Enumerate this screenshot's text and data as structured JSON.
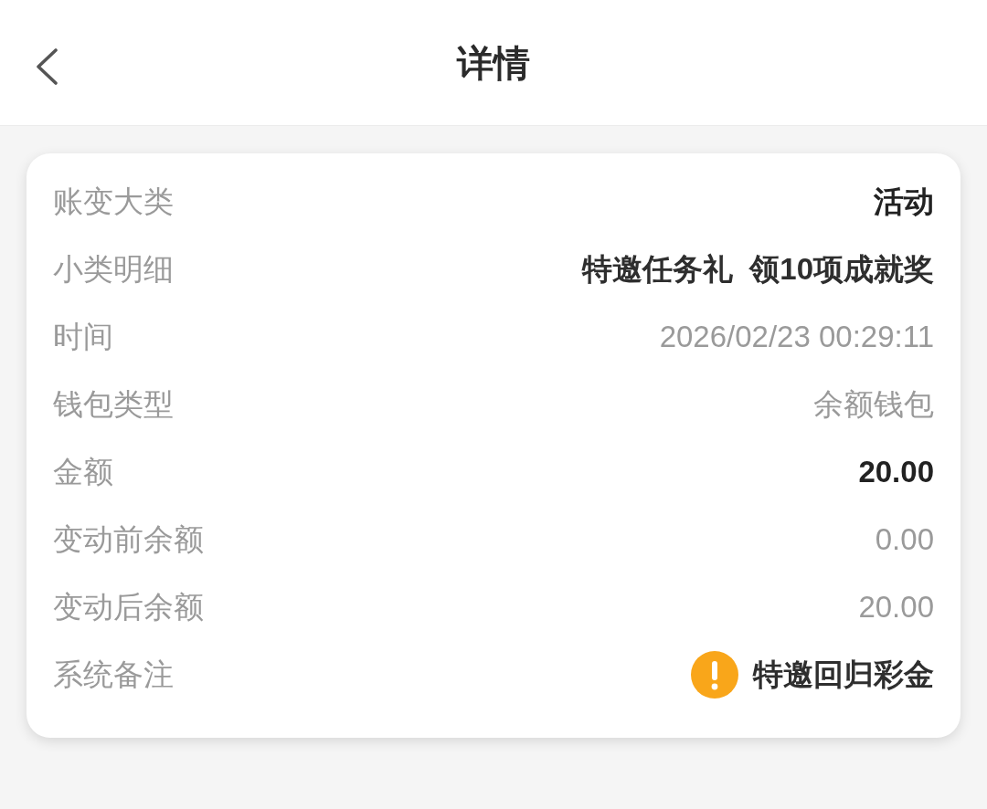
{
  "header": {
    "title": "详情"
  },
  "rows": [
    {
      "label": "账变大类",
      "value": "活动",
      "kind": "bold"
    },
    {
      "label": "小类明细",
      "value": "特邀任务礼  领10项成就奖",
      "kind": "plain"
    },
    {
      "label": "时间",
      "value": "2026/02/23 00:29:11",
      "kind": "muted"
    },
    {
      "label": "钱包类型",
      "value": "余额钱包",
      "kind": "muted"
    },
    {
      "label": "金额",
      "value": "20.00",
      "kind": "bold"
    },
    {
      "label": "变动前余额",
      "value": "0.00",
      "kind": "muted"
    },
    {
      "label": "变动后余额",
      "value": "20.00",
      "kind": "muted"
    },
    {
      "label": "系统备注",
      "value": "特邀回归彩金",
      "kind": "warning"
    }
  ]
}
